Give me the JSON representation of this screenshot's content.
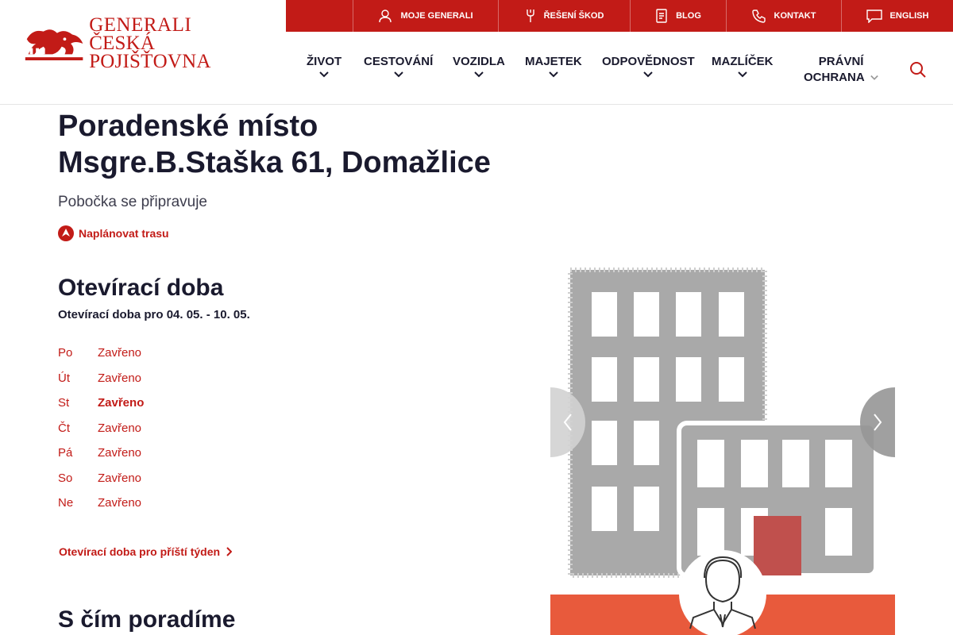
{
  "brand": {
    "line1": "GENERALI",
    "line2": "ČESKÁ POJIŠŤOVNA",
    "color": "#c21b17"
  },
  "topbar": [
    {
      "label": "MOJE GENERALI",
      "icon": "user-icon"
    },
    {
      "label": "ŘEŠENÍ ŠKOD",
      "icon": "wrench-icon"
    },
    {
      "label": "BLOG",
      "icon": "document-icon"
    },
    {
      "label": "KONTAKT",
      "icon": "phone-icon"
    },
    {
      "label": "ENGLISH",
      "icon": "chat-icon"
    }
  ],
  "nav": [
    {
      "label": "ŽIVOT"
    },
    {
      "label": "CESTOVÁNÍ"
    },
    {
      "label": "VOZIDLA"
    },
    {
      "label": "MAJETEK"
    },
    {
      "label": "ODPOVĚDNOST"
    },
    {
      "label": "MAZLÍČEK"
    },
    {
      "label_line1": "PRÁVNÍ",
      "label_line2": "OCHRANA"
    }
  ],
  "page": {
    "title_line1": "Poradenské místo",
    "title_line2": "Msgre.B.Staška 61, Domažlice",
    "subtitle": "Pobočka se připravuje",
    "route_label": "Naplánovat trasu"
  },
  "opening_hours": {
    "heading": "Otevírací doba",
    "range": "Otevírací doba pro 04. 05. - 10. 05.",
    "rows": [
      {
        "day": "Po",
        "value": "Zavřeno"
      },
      {
        "day": "Út",
        "value": "Zavřeno"
      },
      {
        "day": "St",
        "value": "Zavřeno"
      },
      {
        "day": "Čt",
        "value": "Zavřeno"
      },
      {
        "day": "Pá",
        "value": "Zavřeno"
      },
      {
        "day": "So",
        "value": "Zavřeno"
      },
      {
        "day": "Ne",
        "value": "Zavřeno"
      }
    ],
    "next_week_link": "Otevírací doba pro příští týden"
  },
  "advice": {
    "heading": "S čím poradíme"
  },
  "colors": {
    "accent": "#c21b17",
    "text": "#1a1a2e",
    "illustration_orange": "#e85a3c"
  }
}
